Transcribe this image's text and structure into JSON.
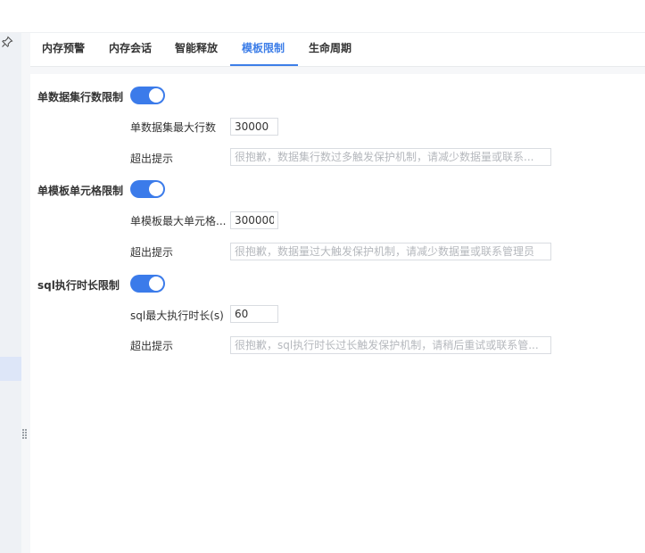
{
  "tabs": [
    {
      "label": "内存预警"
    },
    {
      "label": "内存会话"
    },
    {
      "label": "智能释放"
    },
    {
      "label": "模板限制"
    },
    {
      "label": "生命周期"
    }
  ],
  "active_tab": "模板限制",
  "sections": [
    {
      "title": "单数据集行数限制",
      "enabled": true,
      "limit_label": "单数据集最大行数",
      "limit_value": "30000",
      "tip_label": "超出提示",
      "tip_placeholder": "很抱歉，数据集行数过多触发保护机制，请减少数据量或联系..."
    },
    {
      "title": "单模板单元格限制",
      "enabled": true,
      "limit_label": "单模板最大单元格...",
      "limit_value": "300000",
      "tip_label": "超出提示",
      "tip_placeholder": "很抱歉，数据量过大触发保护机制，请减少数据量或联系管理员"
    },
    {
      "title": "sql执行时长限制",
      "enabled": true,
      "limit_label": "sql最大执行时长(s)",
      "limit_value": "60",
      "tip_label": "超出提示",
      "tip_placeholder": "很抱歉，sql执行时长过长触发保护机制，请稍后重试或联系管..."
    }
  ],
  "colors": {
    "accent": "#3d7ee8",
    "toggle_on": "#3b7bea"
  },
  "icons": {
    "pin": "pin-icon",
    "drag": "drag-handle-icon"
  }
}
